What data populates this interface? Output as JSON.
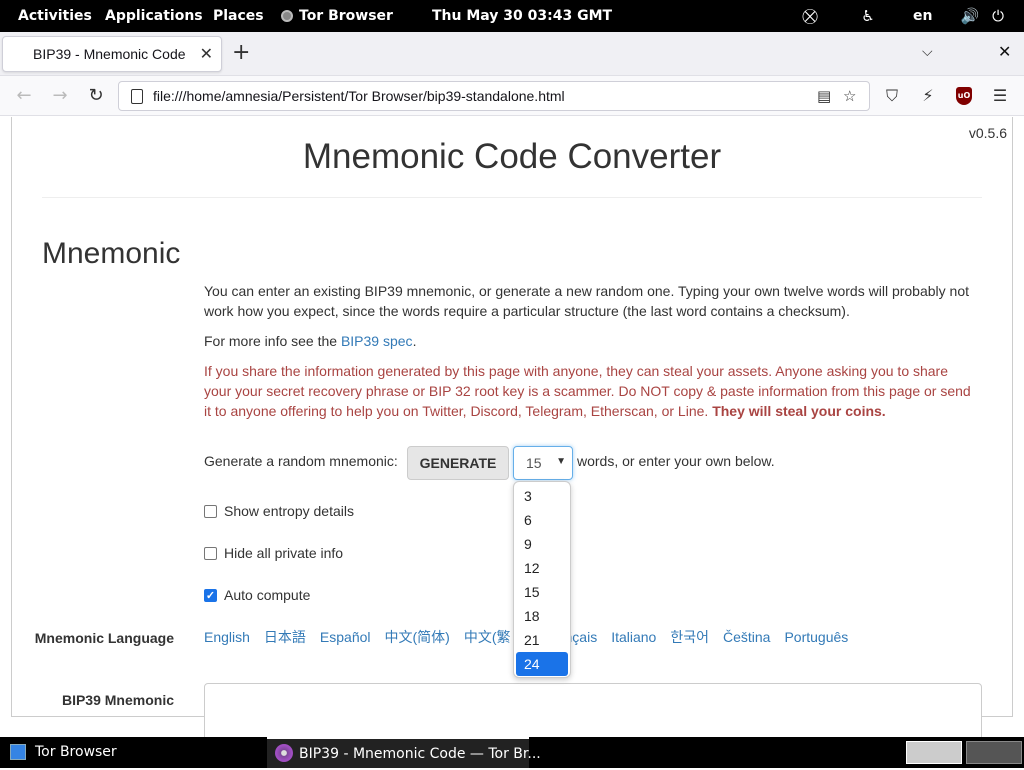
{
  "system_bar": {
    "activities": "Activities",
    "applications": "Applications",
    "places": "Places",
    "app_name": "Tor Browser",
    "clock": "Thu May 30  03:43 GMT",
    "language": "en"
  },
  "browser": {
    "tab_title": "BIP39 - Mnemonic Code",
    "url": "file:///home/amnesia/Persistent/Tor Browser/bip39-standalone.html"
  },
  "page": {
    "version": "v0.5.6",
    "title": "Mnemonic Code Converter",
    "section_title": "Mnemonic",
    "intro": "You can enter an existing BIP39 mnemonic, or generate a new random one. Typing your own twelve words will probably not work how you expect, since the words require a particular structure (the last word contains a checksum).",
    "more_info_prefix": "For more info see the ",
    "more_info_link": "BIP39 spec",
    "more_info_suffix": ".",
    "warning": "If you share the information generated by this page with anyone, they can steal your assets. Anyone asking you to share your your secret recovery phrase or BIP 32 root key is a scammer. Do NOT copy & paste information from this page or send it to anyone offering to help you on Twitter, Discord, Telegram, Etherscan, or Line. ",
    "warning_bold": "They will steal your coins.",
    "generate_label": "Generate a random mnemonic:",
    "generate_button": "GENERATE",
    "word_count_selected": "15",
    "generate_suffix": "words, or enter your own below.",
    "show_entropy": "Show entropy details",
    "hide_private": "Hide all private info",
    "auto_compute": "Auto compute",
    "mnemonic_language_label": "Mnemonic Language",
    "languages": [
      "English",
      "日本語",
      "Español",
      "中文(简体)",
      "中文(繁",
      "nçais",
      "Italiano",
      "한국어",
      "Čeština",
      "Português"
    ],
    "bip39_mnemonic_label": "BIP39 Mnemonic"
  },
  "word_count_options": [
    "3",
    "6",
    "9",
    "12",
    "15",
    "18",
    "21",
    "24"
  ],
  "taskbar": {
    "launcher": "Tor Browser",
    "window": "BIP39 - Mnemonic Code — Tor Br..."
  }
}
